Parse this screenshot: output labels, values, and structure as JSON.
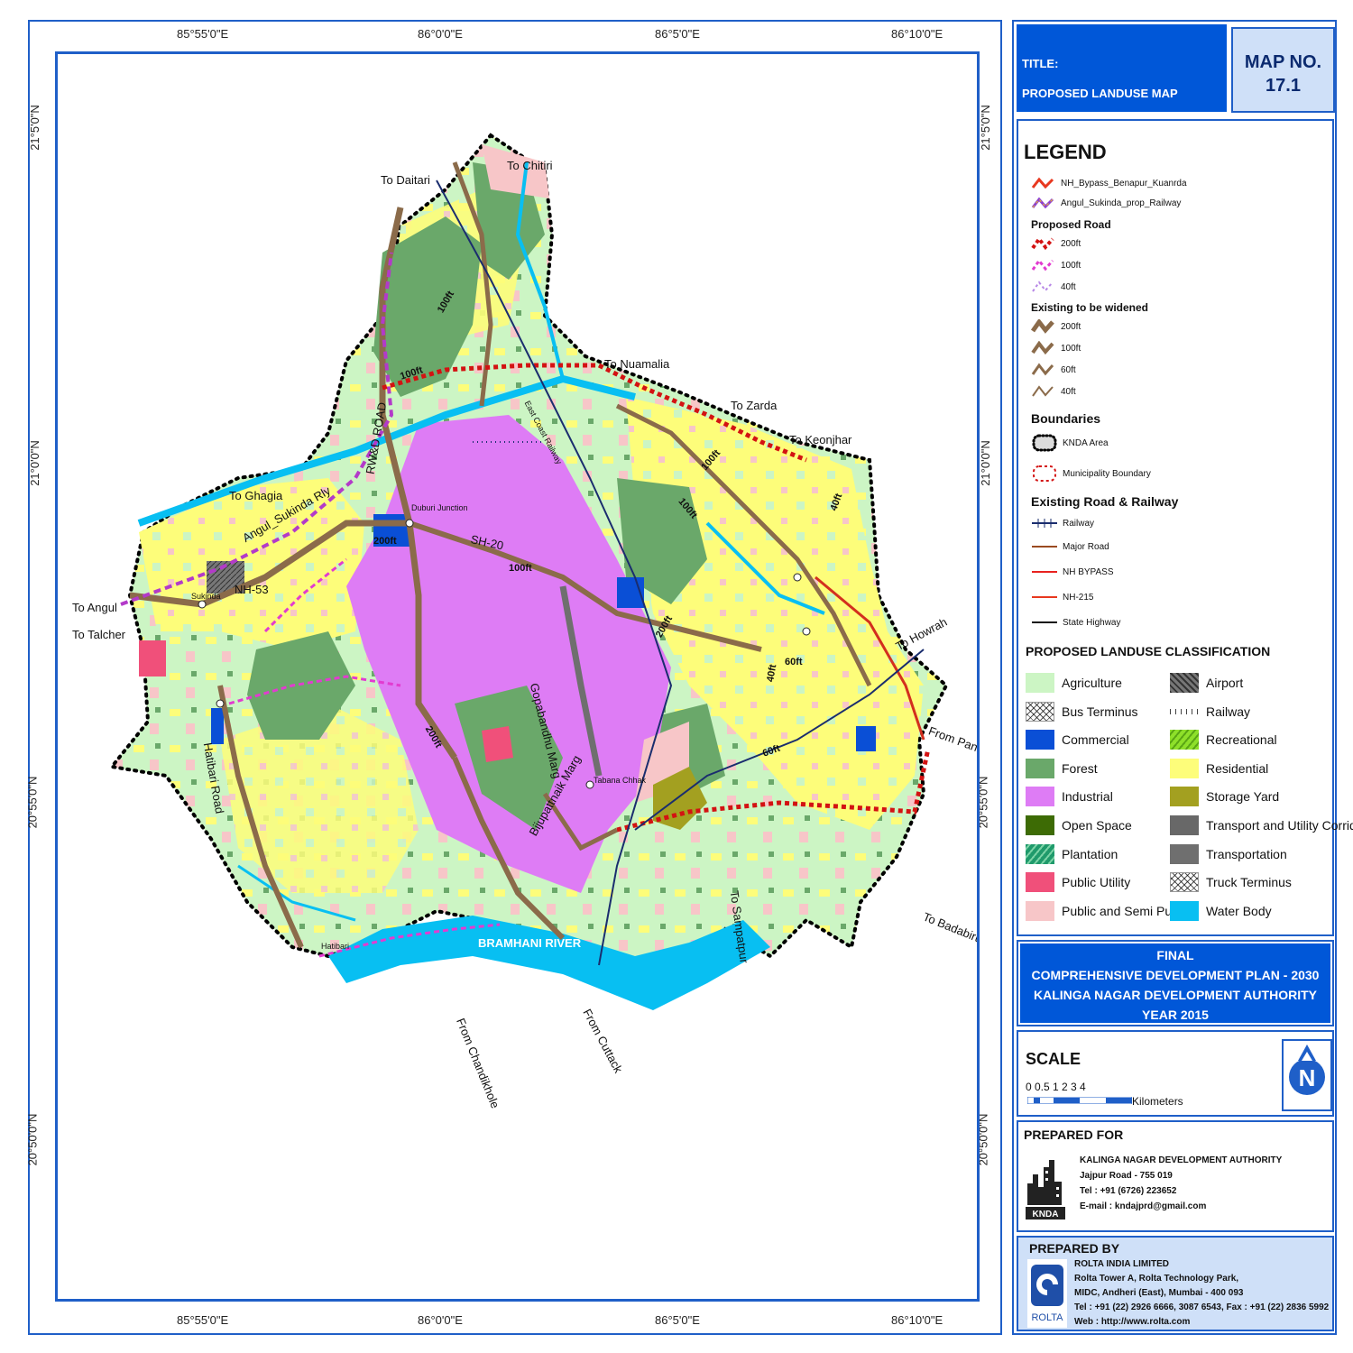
{
  "map": {
    "coords_top": [
      "85°55'0\"E",
      "86°0'0\"E",
      "86°5'0\"E",
      "86°10'0\"E"
    ],
    "coords_bottom": [
      "85°55'0\"E",
      "86°0'0\"E",
      "86°5'0\"E",
      "86°10'0\"E"
    ],
    "coords_left": [
      "21°5'0\"N",
      "21°0'0\"N",
      "20°55'0\"N",
      "20°50'0\"N"
    ],
    "coords_right": [
      "21°5'0\"N",
      "21°0'0\"N",
      "20°55'0\"N",
      "20°50'0\"N"
    ],
    "labels": {
      "to_chitiri": "To Chitiri",
      "to_daitari": "To Daitari",
      "to_nuamalia": "To Nuamalia",
      "to_zarda": "To Zarda",
      "to_keonjhar": "To Keonjhar",
      "to_ghagia": "To Ghagia",
      "to_angul": "To Angul",
      "to_talcher": "To Talcher",
      "to_howrah": "To Howrah",
      "from_panikoili": "From Panikoili",
      "to_sampatpur": "To Sampatpur",
      "to_badabiruan": "To Badabiruan",
      "from_chandikhole": "From Chandikhole",
      "from_cuttack": "From Cuttack",
      "bramhani_river": "BRAMHANI RIVER",
      "hatibari_road": "Hatibari Road",
      "rwd_road": "RW&D ROAD",
      "angul_sukinda_rly": "Angul_Sukinda Rly",
      "nh53": "NH-53",
      "sh20": "SH-20",
      "gopabandhu_marg": "Gopabandhu Marg",
      "bijupattnaik_marg": "Bijupattnaik Marg",
      "duburi_junction": "Duburi Junction",
      "sukinda": "Sukinda",
      "hatibari": "Hatibari",
      "tabana_chhak": "Tabana Chhak",
      "east_coast_railway": "East Coast Railway",
      "r200ft_a": "200ft",
      "r200ft_b": "200ft",
      "r200ft_c": "200ft",
      "r100ft_a": "100ft",
      "r100ft_b": "100ft",
      "r100ft_c": "100ft",
      "r100ft_d": "100ft",
      "r100ft_e": "100ft",
      "r60ft_a": "60ft",
      "r60ft_b": "60ft",
      "r40ft_a": "40ft",
      "r40ft_b": "40ft"
    }
  },
  "title_block": {
    "title_label": "TITLE:",
    "title_value": "PROPOSED LANDUSE MAP",
    "map_no_label": "MAP NO.",
    "map_no_value": "17.1"
  },
  "legend": {
    "heading": "LEGEND",
    "nh_bypass": "NH_Bypass_Benapur_Kuanrda",
    "angul_rail": "Angul_Sukinda_prop_Railway",
    "proposed_road": "Proposed Road",
    "p200": "200ft",
    "p100": "100ft",
    "p40": "40ft",
    "existing_widened": "Existing to be widened",
    "e200": "200ft",
    "e100": "100ft",
    "e60": "60ft",
    "e40": "40ft",
    "boundaries": "Boundaries",
    "knda_area": "KNDA Area",
    "municipality_boundary": "Municipality Boundary",
    "existing_road_railway": "Existing Road & Railway",
    "railway": "Railway",
    "major_road": "Major Road",
    "nh_bypass_line": "NH BYPASS",
    "nh215": "NH-215",
    "state_highway": "State Highway",
    "classification_heading": "PROPOSED LANDUSE CLASSIFICATION",
    "classes_left": [
      {
        "label": "Agriculture",
        "color": "#ccf5c4"
      },
      {
        "label": "Bus Terminus",
        "color": "#ffffff"
      },
      {
        "label": "Commercial",
        "color": "#0a4fd6"
      },
      {
        "label": "Forest",
        "color": "#6aa86a"
      },
      {
        "label": "Industrial",
        "color": "#de7cf5"
      },
      {
        "label": "Open Space",
        "color": "#3d6b05"
      },
      {
        "label": "Plantation",
        "color": "#1f9a6b"
      },
      {
        "label": "Public Utility",
        "color": "#f0507a"
      },
      {
        "label": "Public and Semi Public",
        "color": "#f7c6c8"
      }
    ],
    "classes_right": [
      {
        "label": "Airport",
        "color": "#666666"
      },
      {
        "label": "Railway",
        "color": "#ffffff"
      },
      {
        "label": "Recreational",
        "color": "#8ee02a"
      },
      {
        "label": "Residential",
        "color": "#fdfd7a"
      },
      {
        "label": "Storage Yard",
        "color": "#a3a020"
      },
      {
        "label": "Transport and Utility Corridor",
        "color": "#686868"
      },
      {
        "label": "Transportation",
        "color": "#6f6f6f"
      },
      {
        "label": "Truck Terminus",
        "color": "#ffffff"
      },
      {
        "label": "Water Body",
        "color": "#08bff2"
      }
    ]
  },
  "plan_block": {
    "line1": "FINAL",
    "line2": "COMPREHENSIVE DEVELOPMENT PLAN - 2030",
    "line3": "KALINGA NAGAR DEVELOPMENT AUTHORITY",
    "line4": "YEAR 2015"
  },
  "scale_block": {
    "title": "SCALE",
    "ticks": "0 0.5 1      2      3      4",
    "unit": "Kilometers"
  },
  "prepared_for": {
    "heading": "PREPARED FOR",
    "org": "KALINGA NAGAR DEVELOPMENT AUTHORITY",
    "addr": "Jajpur Road - 755 019",
    "tel": "Tel : +91 (6726) 223652",
    "email": "E-mail : kndajprd@gmail.com",
    "logo_text": "KNDA"
  },
  "prepared_by": {
    "heading": "PREPARED BY",
    "org": "ROLTA INDIA LIMITED",
    "addr1": "Rolta Tower A, Rolta Technology Park,",
    "addr2": "MIDC, Andheri (East), Mumbai - 400 093",
    "tel": "Tel : +91 (22) 2926 6666, 3087 6543, Fax : +91 (22) 2836 5992",
    "web": "Web : http://www.rolta.com",
    "logo_text": "ROLTA"
  }
}
